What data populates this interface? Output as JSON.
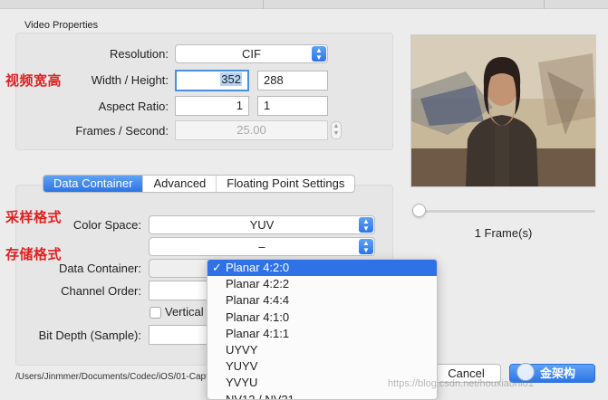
{
  "video_properties": {
    "title": "Video Properties",
    "resolution_label": "Resolution:",
    "resolution_value": "CIF",
    "width_height_label": "Width / Height:",
    "width": "352",
    "height": "288",
    "aspect_ratio_label": "Aspect Ratio:",
    "aspect_w": "1",
    "aspect_h": "1",
    "fps_label": "Frames / Second:",
    "fps_value": "25.00"
  },
  "annotations": {
    "width_height_note": "视频宽高",
    "color_space_note": "采样格式",
    "storage_note": "存储格式"
  },
  "tabs": [
    "Data Container",
    "Advanced",
    "Floating Point Settings"
  ],
  "container": {
    "color_space_label": "Color Space:",
    "color_space_value": "YUV",
    "subsampling_value": "–",
    "data_container_label": "Data Container:",
    "channel_order_label": "Channel Order:",
    "vertical_label": "Vertical",
    "bit_depth_label": "Bit Depth (Sample):"
  },
  "dropdown_items": [
    {
      "label": "Planar 4:2:0",
      "checked": true
    },
    {
      "label": "Planar 4:2:2",
      "checked": false
    },
    {
      "label": "Planar 4:4:4",
      "checked": false
    },
    {
      "label": "Planar 4:1:0",
      "checked": false
    },
    {
      "label": "Planar 4:1:1",
      "checked": false
    },
    {
      "label": "UYVY",
      "checked": false
    },
    {
      "label": "YUYV",
      "checked": false
    },
    {
      "label": "YVYU",
      "checked": false
    },
    {
      "label": "NV12 / NV21",
      "checked": false
    }
  ],
  "dropdown_checkmark": "✓",
  "preview": {
    "frame_label": "1 Frame(s)",
    "slider_value": 0
  },
  "file_path": "/Users/Jinmmer/Documents/Codec/iOS/01-Capt",
  "buttons": {
    "cancel": "Cancel"
  },
  "watermark": {
    "url": "https://blog.csdn.net/houxiaoni01",
    "logo": "金架构"
  },
  "colors": {
    "accent": "#2f72e8",
    "annotation": "#e02020"
  }
}
